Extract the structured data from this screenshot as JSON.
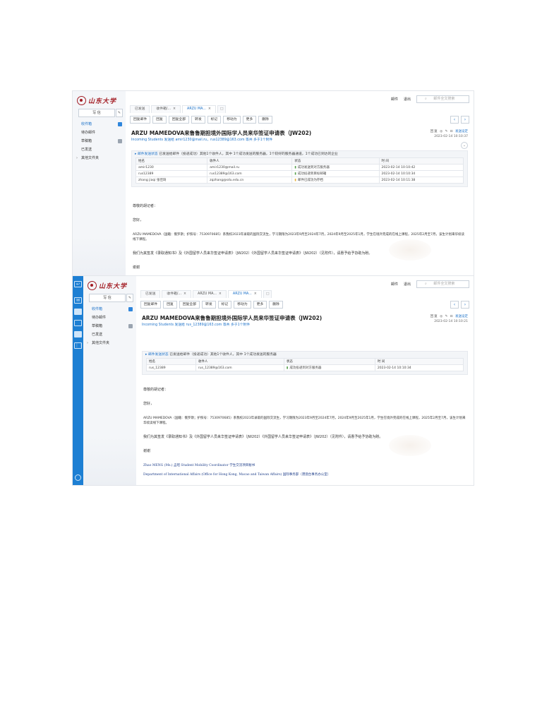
{
  "brand": {
    "logo_text": "山东大学"
  },
  "top": {
    "user": "邮件",
    "settings": "退出",
    "search_placeholder": "邮件全文搜索"
  },
  "sidebar": {
    "compose_label": "写 信",
    "folders": [
      {
        "label": "收件箱"
      },
      {
        "label": "待办邮件"
      },
      {
        "label": "草稿箱"
      },
      {
        "label": "已发送"
      },
      {
        "label": "其他文件夹"
      }
    ]
  },
  "toolbar": [
    "回复邮件",
    "回复",
    "回复全部",
    "转发",
    "标记",
    "移动为",
    "更多",
    "删除"
  ],
  "email": {
    "subject": "ARZU MAMEDOVA来鲁鲁期担境外国际学人员来华签证申请表（JW202)",
    "tracking_label": "▸ 邮件发送状态",
    "status_columns": [
      "姓名",
      "收件人",
      "状态",
      "时 间"
    ],
    "greeting": "尊敬的胡记者：",
    "hello": "您好，",
    "body_para": "ARZU MAMEDOVA（国籍：俄罗斯；护照号：7530970685）系我校2023年录取的国际交流生，学习期限为2023年9月至2024年7月，2024年9月至2025年1月，学生在境外完成的在线上课程，2025年2月至7月，该生计划来华续读线下课程。",
    "request_para": "我们为其签发《录取通知书》及《外国留学人员来华签证申请表》（JW202）《外国留学人员来华签证申请表》（JW202）（见附件），请惠予给予协助为盼。",
    "closing": "谢谢"
  },
  "views": [
    {
      "tabs": [
        "已发送",
        "收件箱/...",
        "ARZU MA..."
      ],
      "meta_date": "2023-02-14 10:10:37",
      "sender_line": "Incoming Students 发送给 amir1230@mail.ru，rus12389@163.com 等共 多于1个附件",
      "status_summary": "已发送给邮件（投递成功）其他1个收件人，其中 1个成功发送的服务器，1个较好的服务器通道，1个成功已到达的企业",
      "rows": [
        [
          "amir1230",
          "amir1230@mail.ru",
          "成功发送到对方服务器",
          "2023-02-14 10:10:42"
        ],
        [
          "rus12389",
          "rus12389@163.com",
          "成功投递到目标邮箱",
          "2023-02-14 10:10:34"
        ],
        [
          "zhang jiaqi 张佳琦",
          "zqzhang@sdu.edu.cn",
          "邮件已成功为存档",
          "2023-02-14 10:11:38"
        ]
      ]
    },
    {
      "tabs": [
        "已发送",
        "收件箱/...",
        "ARZU MA...",
        "ARZU MA..."
      ],
      "meta_date": "2023-02-14 10:10:21",
      "sender_line": "Incoming Students 发送给 rus_12389@163.com 等共 多于1个附件",
      "status_summary": "已发送给邮件（投递成功）其他1个收件人，其中 1个成功发送的服务器",
      "rows": [
        [
          "rus_12389",
          "rus_12389@163.com",
          "成功投递到对方服务器",
          "2023-02-14 10:10:34"
        ]
      ],
      "signature_name": "Zhao MENG (Ms.) 孟昭 Student Mobility Coordinator 学生交流项目秘书",
      "signature_dept": "Department of International Affairs (Office for Hong Kong, Macao and Taiwan Affairs) 国际事务部（港澳台事务办公室）"
    }
  ],
  "meta_actions": "回复 ◎ ✎ ⊡",
  "meta_link": "发送设定"
}
